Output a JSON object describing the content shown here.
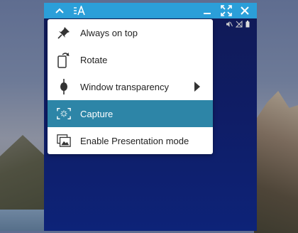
{
  "window": {
    "title_icon": "text-size-icon"
  },
  "title_bar": {
    "controls": [
      "collapse-icon",
      "minimize-icon",
      "fullscreen-icon",
      "close-icon"
    ],
    "accent_color": "#2b9fd9"
  },
  "status_bar": {
    "icons": [
      "mute-icon",
      "no-signal-icon",
      "battery-icon"
    ]
  },
  "menu": {
    "items": [
      {
        "label": "Always on top",
        "icon": "pin-icon"
      },
      {
        "label": "Rotate",
        "icon": "rotate-icon"
      },
      {
        "label": "Window transparency",
        "icon": "transparency-icon",
        "has_submenu": true
      },
      {
        "label": "Capture",
        "icon": "capture-icon",
        "selected": true
      },
      {
        "label": "Enable Presentation mode",
        "icon": "presentation-icon"
      }
    ],
    "selected_color": "#2d85a7"
  }
}
